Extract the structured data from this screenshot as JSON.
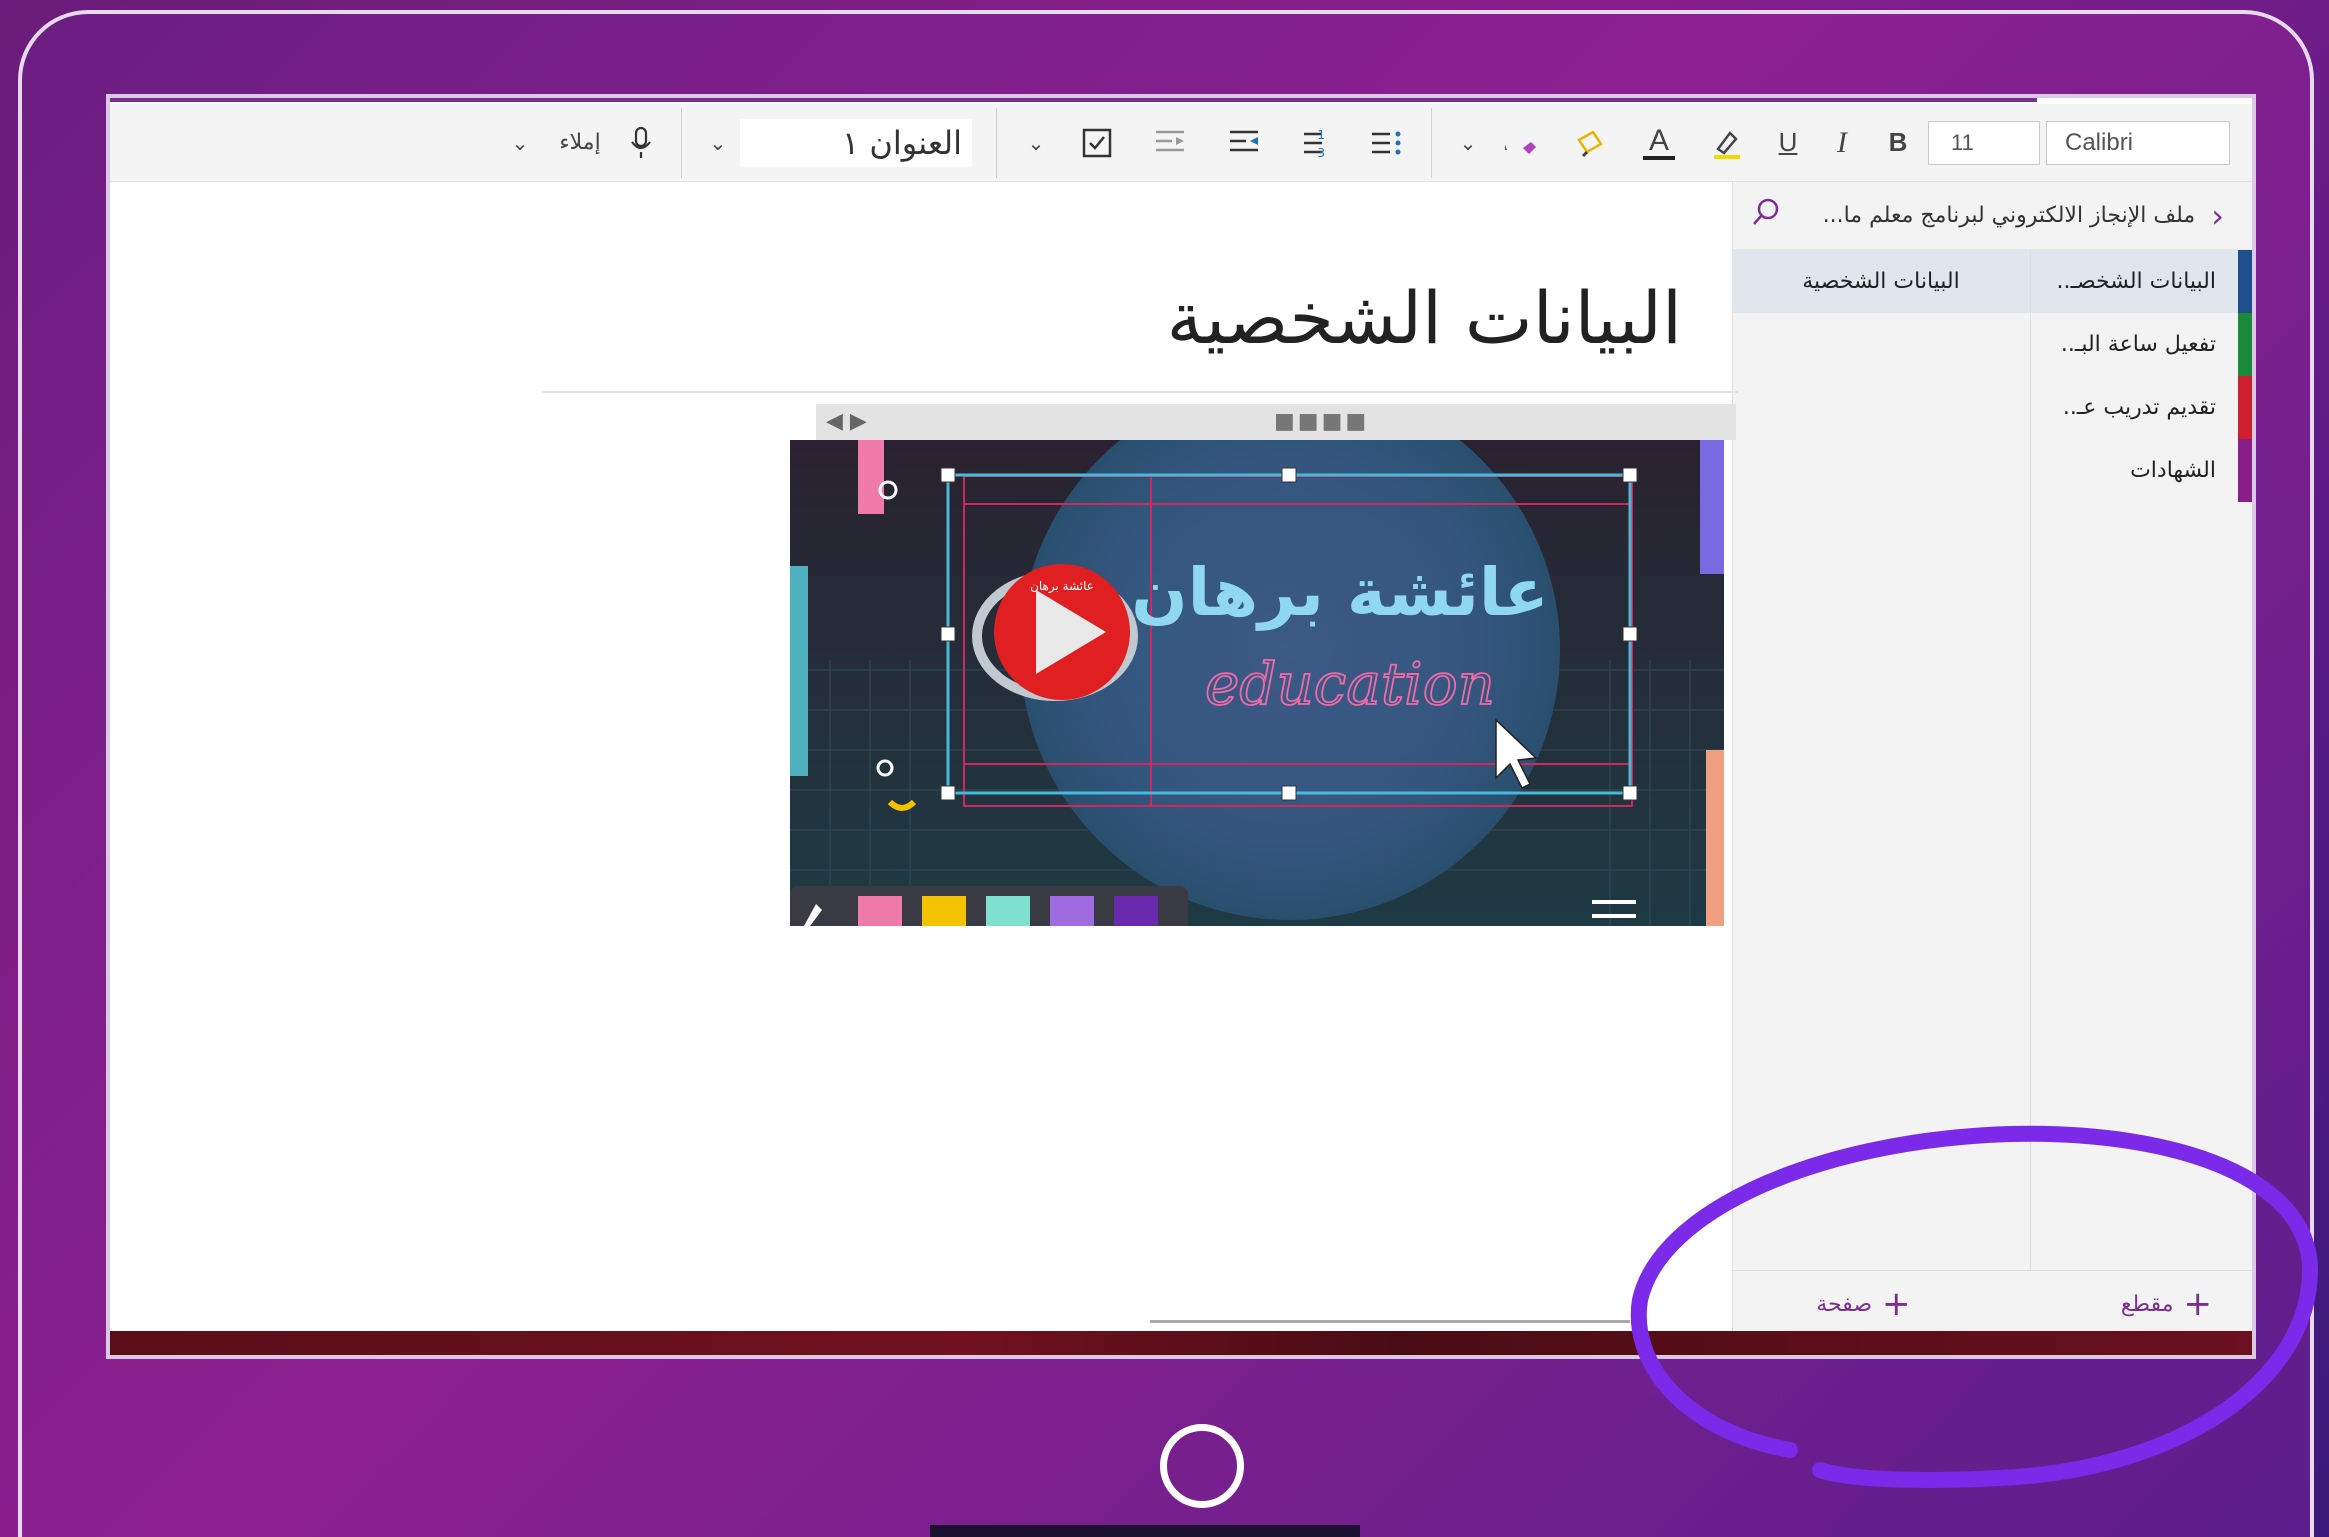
{
  "toolbar": {
    "font_name": "Calibri",
    "font_size": "11",
    "bold": "B",
    "italic": "I",
    "underline": "U",
    "font_color_letter": "A",
    "style_value": "العنوان ١",
    "dictate_label": "إملاء"
  },
  "navigation": {
    "notebook_title": "ملف الإنجاز الالكتروني لبرنامج معلم ما...",
    "sections": [
      {
        "label": "البيانات الشخصـ..",
        "color": "#1f4e8c"
      },
      {
        "label": "تفعيل ساعة البـ..",
        "color": "#1a8a3a"
      },
      {
        "label": "تقديم تدريب عـ..",
        "color": "#d02030"
      },
      {
        "label": "الشهادات",
        "color": "#8a1f8c"
      }
    ],
    "pages": [
      {
        "label": "البيانات الشخصية"
      }
    ],
    "add_section": "مقطع",
    "add_page": "صفحة"
  },
  "page": {
    "title": "البيانات الشخصية"
  },
  "image": {
    "brand_arabic": "عائشة برهان",
    "brand_latin": "education",
    "logo_text": "عائشة برهان"
  },
  "colors": {
    "accent": "#7b2e8f",
    "highlight_circle": "#7a2ae8",
    "swatches": [
      "#f07aa8",
      "#f5c200",
      "#7fe0d0",
      "#a06ae0",
      "#6a2ab0"
    ]
  }
}
